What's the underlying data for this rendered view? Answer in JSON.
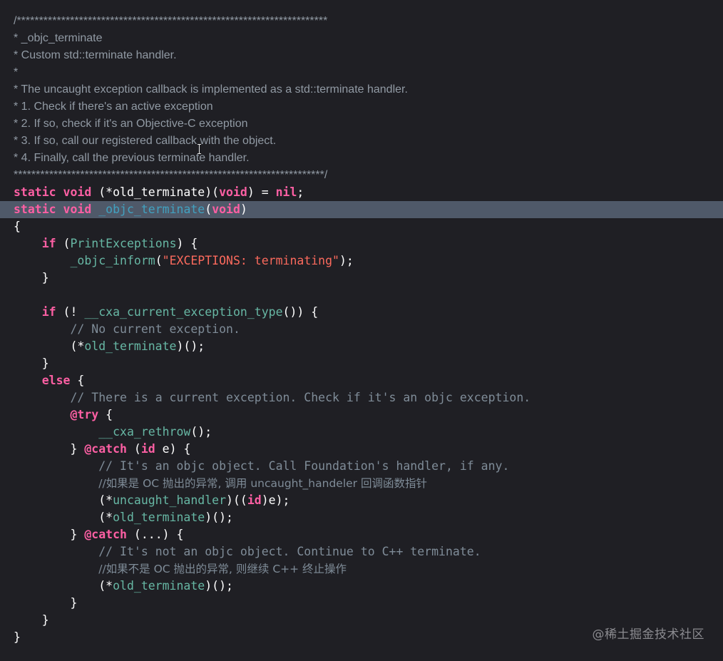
{
  "editor": {
    "lines": [
      [
        {
          "t": "/**********************************************************************",
          "c": "doc"
        }
      ],
      [
        {
          "t": "* _objc_terminate",
          "c": "doc"
        }
      ],
      [
        {
          "t": "* Custom std::terminate handler.",
          "c": "doc"
        }
      ],
      [
        {
          "t": "*",
          "c": "doc"
        }
      ],
      [
        {
          "t": "* The uncaught exception callback is implemented as a std::terminate handler.",
          "c": "doc"
        }
      ],
      [
        {
          "t": "* 1. Check if there's an active exception",
          "c": "doc"
        }
      ],
      [
        {
          "t": "* 2. If so, check if it's an Objective-C exception",
          "c": "doc"
        }
      ],
      [
        {
          "t": "* 3. If so, call our registered callback with the object.",
          "c": "doc"
        }
      ],
      [
        {
          "t": "* 4. Finally, call the previous terminate handler.",
          "c": "doc"
        }
      ],
      [
        {
          "t": "**********************************************************************/",
          "c": "doc"
        }
      ],
      [
        {
          "t": "static",
          "c": "kw"
        },
        {
          "t": " ",
          "c": "plain"
        },
        {
          "t": "void",
          "c": "kw"
        },
        {
          "t": " (*old_terminate)(",
          "c": "plain"
        },
        {
          "t": "void",
          "c": "kw"
        },
        {
          "t": ") = ",
          "c": "plain"
        },
        {
          "t": "nil",
          "c": "kw"
        },
        {
          "t": ";",
          "c": "plain"
        }
      ],
      [
        {
          "t": "static",
          "c": "kw"
        },
        {
          "t": " ",
          "c": "plain"
        },
        {
          "t": "void",
          "c": "kw"
        },
        {
          "t": " ",
          "c": "plain"
        },
        {
          "t": "_objc_terminate",
          "c": "func"
        },
        {
          "t": "(",
          "c": "plain"
        },
        {
          "t": "void",
          "c": "kw"
        },
        {
          "t": ")",
          "c": "plain"
        }
      ],
      [
        {
          "t": "{",
          "c": "plain"
        }
      ],
      [
        {
          "t": "    ",
          "c": "plain"
        },
        {
          "t": "if",
          "c": "kw"
        },
        {
          "t": " (",
          "c": "plain"
        },
        {
          "t": "PrintExceptions",
          "c": "ident"
        },
        {
          "t": ") {",
          "c": "plain"
        }
      ],
      [
        {
          "t": "        ",
          "c": "plain"
        },
        {
          "t": "_objc_inform",
          "c": "ident"
        },
        {
          "t": "(",
          "c": "plain"
        },
        {
          "t": "\"EXCEPTIONS: terminating\"",
          "c": "str"
        },
        {
          "t": ");",
          "c": "plain"
        }
      ],
      [
        {
          "t": "    }",
          "c": "plain"
        }
      ],
      [
        {
          "t": "",
          "c": "plain"
        }
      ],
      [
        {
          "t": "    ",
          "c": "plain"
        },
        {
          "t": "if",
          "c": "kw"
        },
        {
          "t": " (! ",
          "c": "plain"
        },
        {
          "t": "__cxa_current_exception_type",
          "c": "ident"
        },
        {
          "t": "()) {",
          "c": "plain"
        }
      ],
      [
        {
          "t": "        ",
          "c": "plain"
        },
        {
          "t": "// No current exception.",
          "c": "comment"
        }
      ],
      [
        {
          "t": "        (*",
          "c": "plain"
        },
        {
          "t": "old_terminate",
          "c": "ident"
        },
        {
          "t": ")();",
          "c": "plain"
        }
      ],
      [
        {
          "t": "    }",
          "c": "plain"
        }
      ],
      [
        {
          "t": "    ",
          "c": "plain"
        },
        {
          "t": "else",
          "c": "kw"
        },
        {
          "t": " {",
          "c": "plain"
        }
      ],
      [
        {
          "t": "        ",
          "c": "plain"
        },
        {
          "t": "// There is a current exception. Check if it's an objc exception.",
          "c": "comment"
        }
      ],
      [
        {
          "t": "        ",
          "c": "plain"
        },
        {
          "t": "@try",
          "c": "kw"
        },
        {
          "t": " {",
          "c": "plain"
        }
      ],
      [
        {
          "t": "            ",
          "c": "plain"
        },
        {
          "t": "__cxa_rethrow",
          "c": "ident"
        },
        {
          "t": "();",
          "c": "plain"
        }
      ],
      [
        {
          "t": "        } ",
          "c": "plain"
        },
        {
          "t": "@catch",
          "c": "kw"
        },
        {
          "t": " (",
          "c": "plain"
        },
        {
          "t": "id",
          "c": "kw"
        },
        {
          "t": " e) {",
          "c": "plain"
        }
      ],
      [
        {
          "t": "            ",
          "c": "plain"
        },
        {
          "t": "// It's an objc object. Call Foundation's handler, if any.",
          "c": "comment"
        }
      ],
      [
        {
          "t": "            ",
          "c": "plain"
        },
        {
          "t": "//如果是 OC 抛出的异常, 调用 uncaught_handeler 回调函数指针",
          "c": "comment"
        }
      ],
      [
        {
          "t": "            (*",
          "c": "plain"
        },
        {
          "t": "uncaught_handler",
          "c": "ident"
        },
        {
          "t": ")((",
          "c": "plain"
        },
        {
          "t": "id",
          "c": "kw"
        },
        {
          "t": ")e);",
          "c": "plain"
        }
      ],
      [
        {
          "t": "            (*",
          "c": "plain"
        },
        {
          "t": "old_terminate",
          "c": "ident"
        },
        {
          "t": ")();",
          "c": "plain"
        }
      ],
      [
        {
          "t": "        } ",
          "c": "plain"
        },
        {
          "t": "@catch",
          "c": "kw"
        },
        {
          "t": " (...) {",
          "c": "plain"
        }
      ],
      [
        {
          "t": "            ",
          "c": "plain"
        },
        {
          "t": "// It's not an objc object. Continue to C++ terminate.",
          "c": "comment"
        }
      ],
      [
        {
          "t": "            ",
          "c": "plain"
        },
        {
          "t": "//如果不是 OC 抛出的异常, 则继续 C++ 终止操作",
          "c": "comment"
        }
      ],
      [
        {
          "t": "            (*",
          "c": "plain"
        },
        {
          "t": "old_terminate",
          "c": "ident"
        },
        {
          "t": ")();",
          "c": "plain"
        }
      ],
      [
        {
          "t": "        }",
          "c": "plain"
        }
      ],
      [
        {
          "t": "    }",
          "c": "plain"
        }
      ],
      [
        {
          "t": "}",
          "c": "plain"
        }
      ]
    ],
    "highlighted_line": 11
  },
  "watermark": "@稀土掘金技术社区",
  "icons": {
    "cursor": "text-cursor-icon"
  },
  "colors": {
    "background": "#1f1f24",
    "keyword": "#fc5fa3",
    "function_name": "#41a1c0",
    "identifier": "#67b7a4",
    "string": "#fc6a5d",
    "comment": "#7f8c98",
    "doc_comment": "#919aa4",
    "selection": "#4f5969"
  }
}
